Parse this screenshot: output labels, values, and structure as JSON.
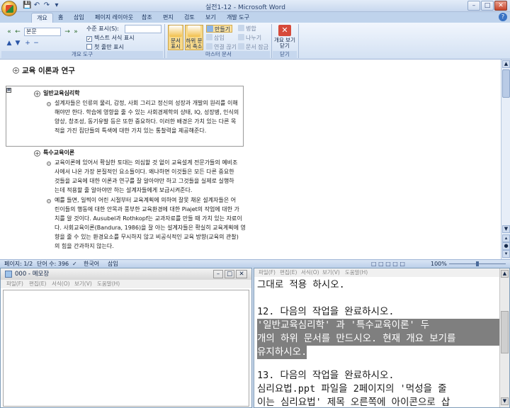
{
  "word": {
    "title": "실전1-12 - Microsoft Word",
    "tabs": [
      "개요",
      "홈",
      "삽입",
      "페이지 레이아웃",
      "참조",
      "편지",
      "검토",
      "보기",
      "개발 도구"
    ],
    "active_tab": "개요",
    "ribbon": {
      "level_select_value": "본문",
      "show_level_label": "수준 표시(S):",
      "show_text_format_label": "텍스트 서식 표시",
      "show_first_line_label": "첫 줄만 표시",
      "outline_tools_group": "개요 도구",
      "show_document_label": "문서 표시",
      "collapse_subdocs_label": "하위 문서 축소",
      "create_label": "만들기",
      "insert_label": "삽입",
      "unlink_label": "연결 끊기",
      "merge_label": "병합",
      "split_label": "나누기",
      "lock_label": "문서 잠금",
      "master_doc_group": "마스터 문서",
      "close_outline_label": "개요 보기 닫기",
      "close_group": "닫기"
    },
    "document": {
      "heading": "교육 이론과 연구",
      "sub1_title": "일반교육심리학",
      "sub1_lines": [
        "설계자들은 인류의 물리, 감정, 사회 그리고 정신의 성장과 개발의 원리를 이해",
        "해야만 한다. 학습에 영향을 줄 수 있는 사회경제학의 상태, IQ, 성장병, 인식의",
        "양상, 창조성, 동기유발 등은 또한 중요하다. 이러한 배경은 가치 있는 다른 목",
        "적을 가진 집단들의 특색에 대한 가치 있는 통찰력을 제공해준다."
      ],
      "sub2_title": "특수교육이론",
      "sub2_para1": [
        "교육이론에 있어서 확실한 토대는 의심할 것 없이 교육설계 전문가들의 예비조",
        "사에서 나온 가장 본질적인 요소들이다. 왜냐하면 이것들은 모든 다른 중요한",
        "것들을 교육에 대한 이론과 연구를 잘 알아야만 하고 그것들을 실제로 실행하",
        "는데 적용할 줄 알아야만 하는 설계자들에게 보급시켜준다."
      ],
      "sub2_para2": [
        "예를 들면, 일찍이 어린 시절부터 교육계획에 의하여 잘못 채운 설계자들은 어",
        "린이들의 행동에 대한 안목과 풍부한 교육환경에 대한 Piajet의 작업에 대한 가",
        "치를 알 것이다. Ausubel과 Rothkopf는 교과자료를 만들 때 가치 있는 자료이",
        "다. 사회교육이론(Bandura, 1986)을 잘 아는 설계자들은 확실히 교육계획에 영",
        "향을 줄 수 있는 환경요소를 무시하지 않고 비공식적인 교육 방향(교육의 관찰)",
        "의 힘을 간과하지 않는다."
      ]
    },
    "status": {
      "page": "페이지: 1/2",
      "words": "단어 수: 396",
      "lang": "한국어",
      "mode": "삽입",
      "zoom": "100%"
    }
  },
  "notepad": {
    "title": "000 - 메모장",
    "menu": [
      "파일(F)",
      "편집(E)",
      "서식(O)",
      "보기(V)",
      "도움말(H)"
    ]
  },
  "instructions": {
    "menu": [
      "파일(F)",
      "편집(E)",
      "서식(O)",
      "보기(V)",
      "도움말(H)"
    ],
    "lines": [
      "  그대로 적용 하시오.",
      "",
      "12. 다음의 작업을 완료하시오.",
      "  '일반교육심리학' 과 '특수교육이론' 두",
      "개의 하위 문서를 만드시오. 현재 개요 보기를",
      "유지하시오.",
      "",
      "13. 다음의 작업을 완료하시오.",
      "  심리요법.ppt 파일을 2페이지의 '먹성을 줄",
      "이는 심리요법' 제목 오른쪽에 아이콘으로 삽"
    ]
  }
}
